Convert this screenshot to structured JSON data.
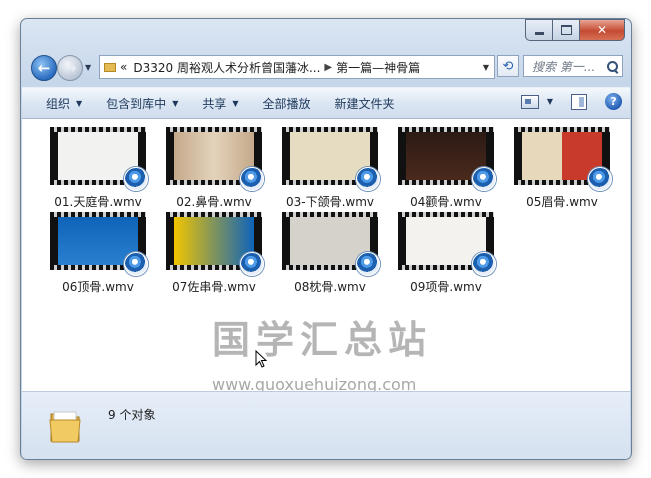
{
  "window": {
    "caption_buttons": {
      "minimize": "minimize",
      "maximize": "maximize",
      "close": "✕"
    }
  },
  "nav": {
    "back_icon": "back-arrow-icon",
    "forward_icon": "forward-arrow-icon",
    "breadcrumb_overflow": "«",
    "breadcrumb_parent": "D3320 周裕观人术分析曾国藩冰...",
    "breadcrumb_sep": "▶",
    "breadcrumb_current": "第一篇—神骨篇",
    "search_placeholder": "搜索 第一..."
  },
  "toolbar": {
    "organize": "组织",
    "include_library": "包含到库中",
    "share": "共享",
    "play_all": "全部播放",
    "new_folder": "新建文件夹"
  },
  "files": [
    {
      "name": "01.天庭骨.wmv",
      "thumb": "portrait-white"
    },
    {
      "name": "02.鼻骨.wmv",
      "thumb": "portrait-tan"
    },
    {
      "name": "03-下颌骨.wmv",
      "thumb": "calligraphy"
    },
    {
      "name": "04颧骨.wmv",
      "thumb": "book-dark"
    },
    {
      "name": "05眉骨.wmv",
      "thumb": "portrait-book"
    },
    {
      "name": "06顶骨.wmv",
      "thumb": "bingjian-blue"
    },
    {
      "name": "07佐串骨.wmv",
      "thumb": "bingjian-yellow"
    },
    {
      "name": "08枕骨.wmv",
      "thumb": "portrait-dark"
    },
    {
      "name": "09项骨.wmv",
      "thumb": "calligraphy-dark"
    }
  ],
  "watermark": {
    "text": "国学汇总站",
    "url": "www.guoxuehuizong.com"
  },
  "details": {
    "count": "9 个对象"
  },
  "colors": {
    "titlebar": "#c7d7ea",
    "toolbar_text": "#1e395b",
    "close_button": "#c44b33"
  }
}
